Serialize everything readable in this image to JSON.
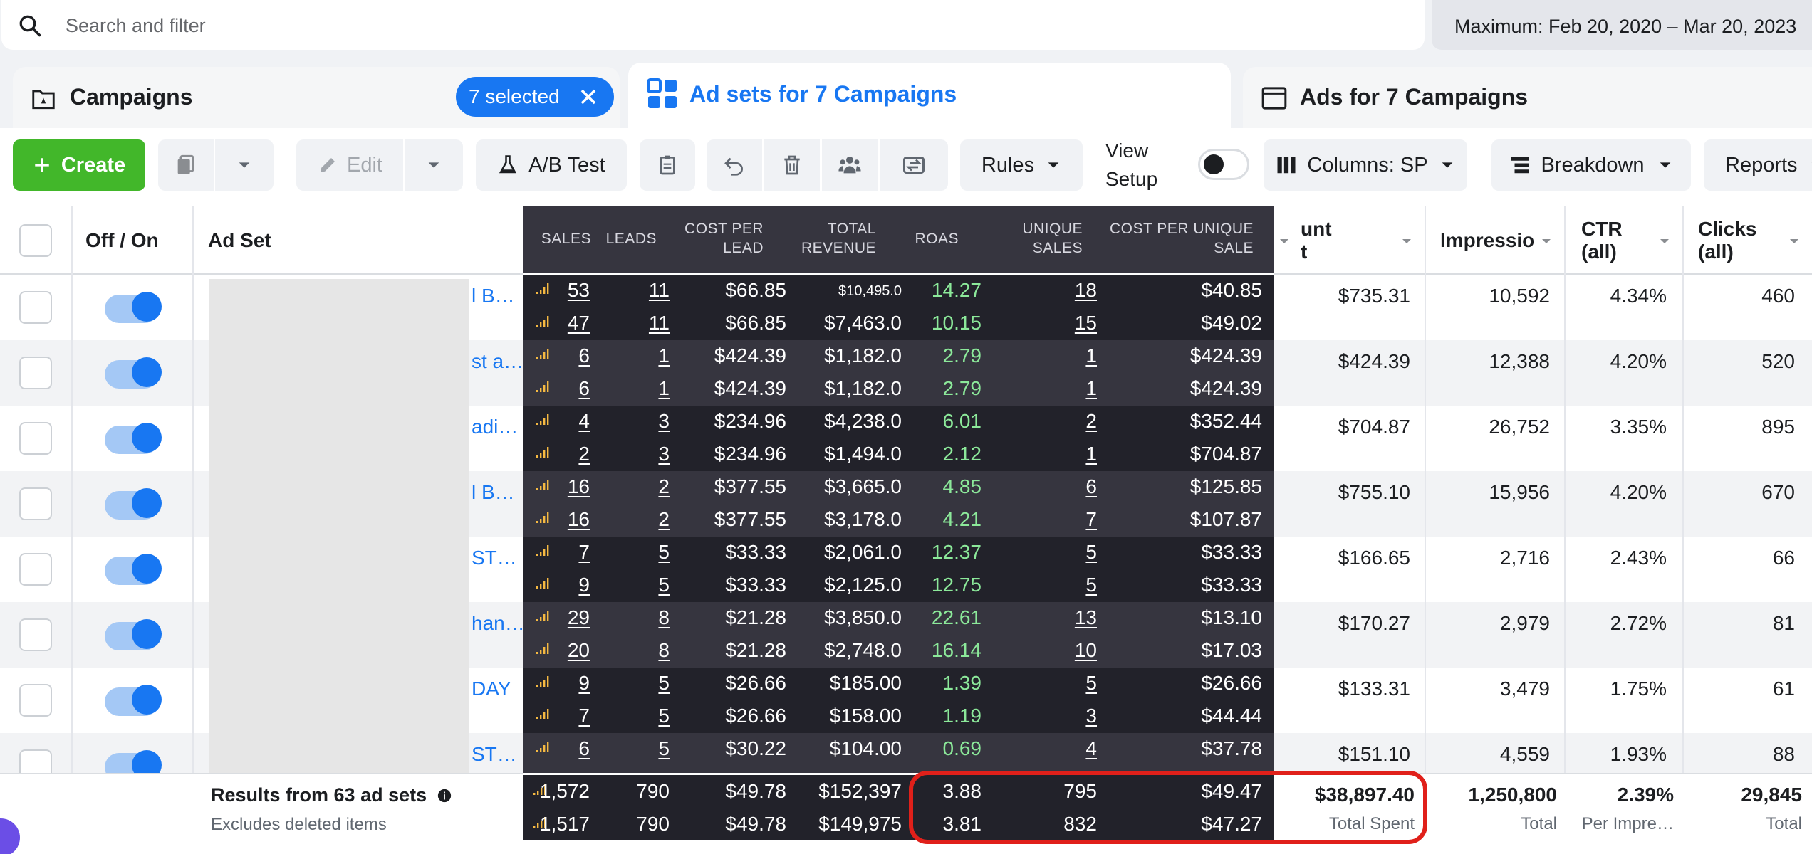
{
  "search": {
    "placeholder": "Search and filter"
  },
  "date_range": "Maximum: Feb 20, 2020 – Mar 20, 2023",
  "tabs": {
    "campaigns": "Campaigns",
    "selected_pill": "7 selected",
    "adsets": "Ad sets for 7 Campaigns",
    "ads": "Ads for 7 Campaigns"
  },
  "toolbar": {
    "create": "Create",
    "edit": "Edit",
    "ab_test": "A/B Test",
    "rules": "Rules",
    "view_setup": [
      "View",
      "Setup"
    ],
    "columns": "Columns: SP",
    "breakdown": "Breakdown",
    "reports": "Reports"
  },
  "headers": {
    "off_on": "Off / On",
    "ad_set": "Ad Set",
    "amount_spent_fragment": [
      "unt",
      "t"
    ],
    "impressions": "Impressio",
    "ctr": [
      "CTR",
      "(all)"
    ],
    "clicks": [
      "Clicks",
      "(all)"
    ]
  },
  "overlay_headers": {
    "sales": "SALES",
    "leads": "LEADS",
    "cost_per_lead": [
      "COST PER",
      "LEAD"
    ],
    "total_revenue": [
      "TOTAL",
      "REVENUE"
    ],
    "roas": "ROAS",
    "unique_sales": [
      "UNIQUE",
      "SALES"
    ],
    "cost_per_unique_sale": [
      "COST PER UNIQUE",
      "SALE"
    ]
  },
  "rows": [
    {
      "name": "l B…",
      "spent": "$735.31",
      "impr": "10,592",
      "ctr": "4.34%",
      "clicks": "460"
    },
    {
      "name": "st a…",
      "spent": "$424.39",
      "impr": "12,388",
      "ctr": "4.20%",
      "clicks": "520"
    },
    {
      "name": "adi…",
      "spent": "$704.87",
      "impr": "26,752",
      "ctr": "3.35%",
      "clicks": "895"
    },
    {
      "name": "l B…",
      "spent": "$755.10",
      "impr": "15,956",
      "ctr": "4.20%",
      "clicks": "670"
    },
    {
      "name": "ST…",
      "spent": "$166.65",
      "impr": "2,716",
      "ctr": "2.43%",
      "clicks": "66"
    },
    {
      "name": "han…",
      "spent": "$170.27",
      "impr": "2,979",
      "ctr": "2.72%",
      "clicks": "81"
    },
    {
      "name": "DAY",
      "spent": "$133.31",
      "impr": "3,479",
      "ctr": "1.75%",
      "clicks": "61"
    },
    {
      "name": "ST…",
      "spent": "$151.10",
      "impr": "4,559",
      "ctr": "1.93%",
      "clicks": "88"
    }
  ],
  "overlay_rows": [
    {
      "sales": "53",
      "leads": "11",
      "cpl": "$66.85",
      "rev": "$10,495.0",
      "roas": "14.27",
      "usales": "18",
      "cpus": "$40.85"
    },
    {
      "sales": "47",
      "leads": "11",
      "cpl": "$66.85",
      "rev": "$7,463.0",
      "roas": "10.15",
      "usales": "15",
      "cpus": "$49.02"
    },
    {
      "sales": "6",
      "leads": "1",
      "cpl": "$424.39",
      "rev": "$1,182.0",
      "roas": "2.79",
      "usales": "1",
      "cpus": "$424.39"
    },
    {
      "sales": "6",
      "leads": "1",
      "cpl": "$424.39",
      "rev": "$1,182.0",
      "roas": "2.79",
      "usales": "1",
      "cpus": "$424.39"
    },
    {
      "sales": "4",
      "leads": "3",
      "cpl": "$234.96",
      "rev": "$4,238.0",
      "roas": "6.01",
      "usales": "2",
      "cpus": "$352.44"
    },
    {
      "sales": "2",
      "leads": "3",
      "cpl": "$234.96",
      "rev": "$1,494.0",
      "roas": "2.12",
      "usales": "1",
      "cpus": "$704.87"
    },
    {
      "sales": "16",
      "leads": "2",
      "cpl": "$377.55",
      "rev": "$3,665.0",
      "roas": "4.85",
      "usales": "6",
      "cpus": "$125.85"
    },
    {
      "sales": "16",
      "leads": "2",
      "cpl": "$377.55",
      "rev": "$3,178.0",
      "roas": "4.21",
      "usales": "7",
      "cpus": "$107.87"
    },
    {
      "sales": "7",
      "leads": "5",
      "cpl": "$33.33",
      "rev": "$2,061.0",
      "roas": "12.37",
      "usales": "5",
      "cpus": "$33.33"
    },
    {
      "sales": "9",
      "leads": "5",
      "cpl": "$33.33",
      "rev": "$2,125.0",
      "roas": "12.75",
      "usales": "5",
      "cpus": "$33.33"
    },
    {
      "sales": "29",
      "leads": "8",
      "cpl": "$21.28",
      "rev": "$3,850.0",
      "roas": "22.61",
      "usales": "13",
      "cpus": "$13.10"
    },
    {
      "sales": "20",
      "leads": "8",
      "cpl": "$21.28",
      "rev": "$2,748.0",
      "roas": "16.14",
      "usales": "10",
      "cpus": "$17.03"
    },
    {
      "sales": "9",
      "leads": "5",
      "cpl": "$26.66",
      "rev": "$185.00",
      "roas": "1.39",
      "usales": "5",
      "cpus": "$26.66"
    },
    {
      "sales": "7",
      "leads": "5",
      "cpl": "$26.66",
      "rev": "$158.00",
      "roas": "1.19",
      "usales": "3",
      "cpus": "$44.44"
    },
    {
      "sales": "6",
      "leads": "5",
      "cpl": "$30.22",
      "rev": "$104.00",
      "roas": "0.69",
      "usales": "4",
      "cpus": "$37.78"
    }
  ],
  "footer": {
    "results": "Results from 63 ad sets",
    "excludes": "Excludes deleted items",
    "totals": [
      {
        "sales": "1,572",
        "leads": "790",
        "cpl": "$49.78",
        "rev": "$152,397",
        "roas": "3.88",
        "usales": "795",
        "cpus": "$49.47"
      },
      {
        "sales": "1,517",
        "leads": "790",
        "cpl": "$49.78",
        "rev": "$149,975",
        "roas": "3.81",
        "usales": "832",
        "cpus": "$47.27"
      }
    ],
    "spent": "$38,897.40",
    "spent_label": "Total Spent",
    "impr": "1,250,800",
    "impr_label": "Total",
    "ctr": "2.39%",
    "ctr_label": "Per Impre…",
    "clicks": "29,845",
    "clicks_label": "Total"
  },
  "colors": {
    "brand_blue": "#1877f2",
    "create_green": "#42b72a",
    "overlay_dark": "#1d1d23",
    "roas_green": "#8ce99a",
    "highlight_red": "#e0201a",
    "spark_yellow": "#f5b942"
  },
  "icons": [
    "search-icon",
    "campaigns-icon",
    "adsets-grid-icon",
    "ads-icon",
    "plus-icon",
    "duplicate-icon",
    "pencil-icon",
    "flask-icon",
    "clipboard-icon",
    "undo-icon",
    "trash-icon",
    "people-icon",
    "export-icon",
    "columns-icon",
    "breakdown-icon",
    "info-icon",
    "sparkline-icon"
  ]
}
